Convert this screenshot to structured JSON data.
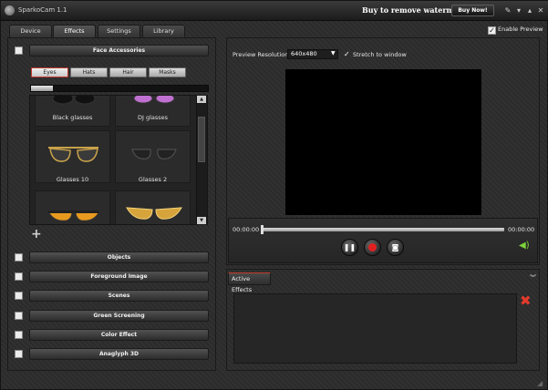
{
  "window": {
    "title": "SparkoCam 1.1",
    "watermark_text": "Buy to remove watermark",
    "buy_label": "Buy Now!"
  },
  "tabs": [
    {
      "label": "Device"
    },
    {
      "label": "Effects",
      "active": true
    },
    {
      "label": "Settings"
    },
    {
      "label": "Library"
    }
  ],
  "enable_preview": {
    "label": "Enable Preview",
    "checked": true
  },
  "face_accessories": {
    "title": "Face Accessories",
    "subtabs": [
      {
        "label": "Eyes",
        "active": true
      },
      {
        "label": "Hats"
      },
      {
        "label": "Hair"
      },
      {
        "label": "Masks"
      }
    ],
    "items": [
      {
        "label": "Black glasses"
      },
      {
        "label": "DJ glasses"
      },
      {
        "label": "Glasses 10"
      },
      {
        "label": "Glasses 2"
      },
      {
        "label": ""
      },
      {
        "label": ""
      }
    ]
  },
  "sections": [
    {
      "label": "Objects"
    },
    {
      "label": "Foreground Image"
    },
    {
      "label": "Scenes"
    },
    {
      "label": "Green Screening"
    },
    {
      "label": "Color Effect"
    },
    {
      "label": "Anaglyph 3D"
    }
  ],
  "preview": {
    "resolution_label": "Preview Resolution:",
    "resolution_value": "640x480",
    "stretch_label": "Stretch to window",
    "stretch_checked": true
  },
  "player": {
    "time_start": "00:00:00",
    "time_end": "00:00:00"
  },
  "active_effects": {
    "tab_label": "Active Effects"
  },
  "colors": {
    "accent_red": "#c0392b",
    "record_red": "#e02020",
    "volume_green": "#7ed43b",
    "delete_red": "#e43a2b"
  }
}
